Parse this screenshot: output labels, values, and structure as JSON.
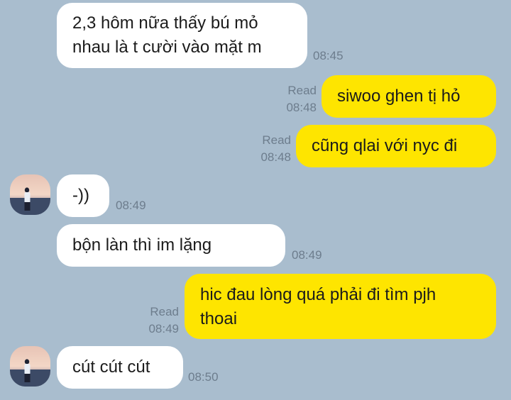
{
  "chat": {
    "messages": [
      {
        "id": "m1",
        "side": "in",
        "text": "2,3 hôm nữa thấy bú mỏ\nnhau là t cười vào mặt m",
        "time": "08:45"
      },
      {
        "id": "m2",
        "side": "out",
        "text": "siwoo ghen tị hỏ",
        "read": "Read",
        "time": "08:48"
      },
      {
        "id": "m3",
        "side": "out",
        "text": "cũng qlai với nyc đi",
        "read": "Read",
        "time": "08:48"
      },
      {
        "id": "m4",
        "side": "in",
        "text": "-))",
        "time": "08:49"
      },
      {
        "id": "m5",
        "side": "in",
        "text": "bộn làn thì im lặng",
        "emoji": "shushing-face-icon",
        "time": "08:49"
      },
      {
        "id": "m6",
        "side": "out",
        "text": "hic đau lòng quá phải đi tìm pjh\nthoai",
        "read": "Read",
        "time": "08:49"
      },
      {
        "id": "m7",
        "side": "in",
        "text": "cút cút cút",
        "time": "08:50"
      }
    ]
  },
  "colors": {
    "background": "#a9bdce",
    "incoming_bubble": "#ffffff",
    "outgoing_bubble": "#fee500",
    "meta_text": "#6d7d8d"
  }
}
